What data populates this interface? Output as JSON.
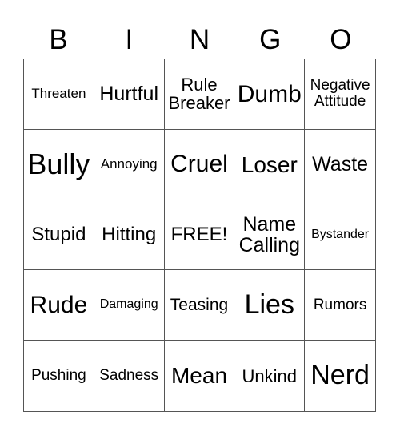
{
  "header": [
    "B",
    "I",
    "N",
    "G",
    "O"
  ],
  "cells": [
    [
      "Threaten",
      "Hurtful",
      "Rule\nBreaker",
      "Dumb",
      "Negative\nAttitude"
    ],
    [
      "Bully",
      "Annoying",
      "Cruel",
      "Loser",
      "Waste"
    ],
    [
      "Stupid",
      "Hitting",
      "FREE!",
      "Name\nCalling",
      "Bystander"
    ],
    [
      "Rude",
      "Damaging",
      "Teasing",
      "Lies",
      "Rumors"
    ],
    [
      "Pushing",
      "Sadness",
      "Mean",
      "Unkind",
      "Nerd"
    ]
  ]
}
